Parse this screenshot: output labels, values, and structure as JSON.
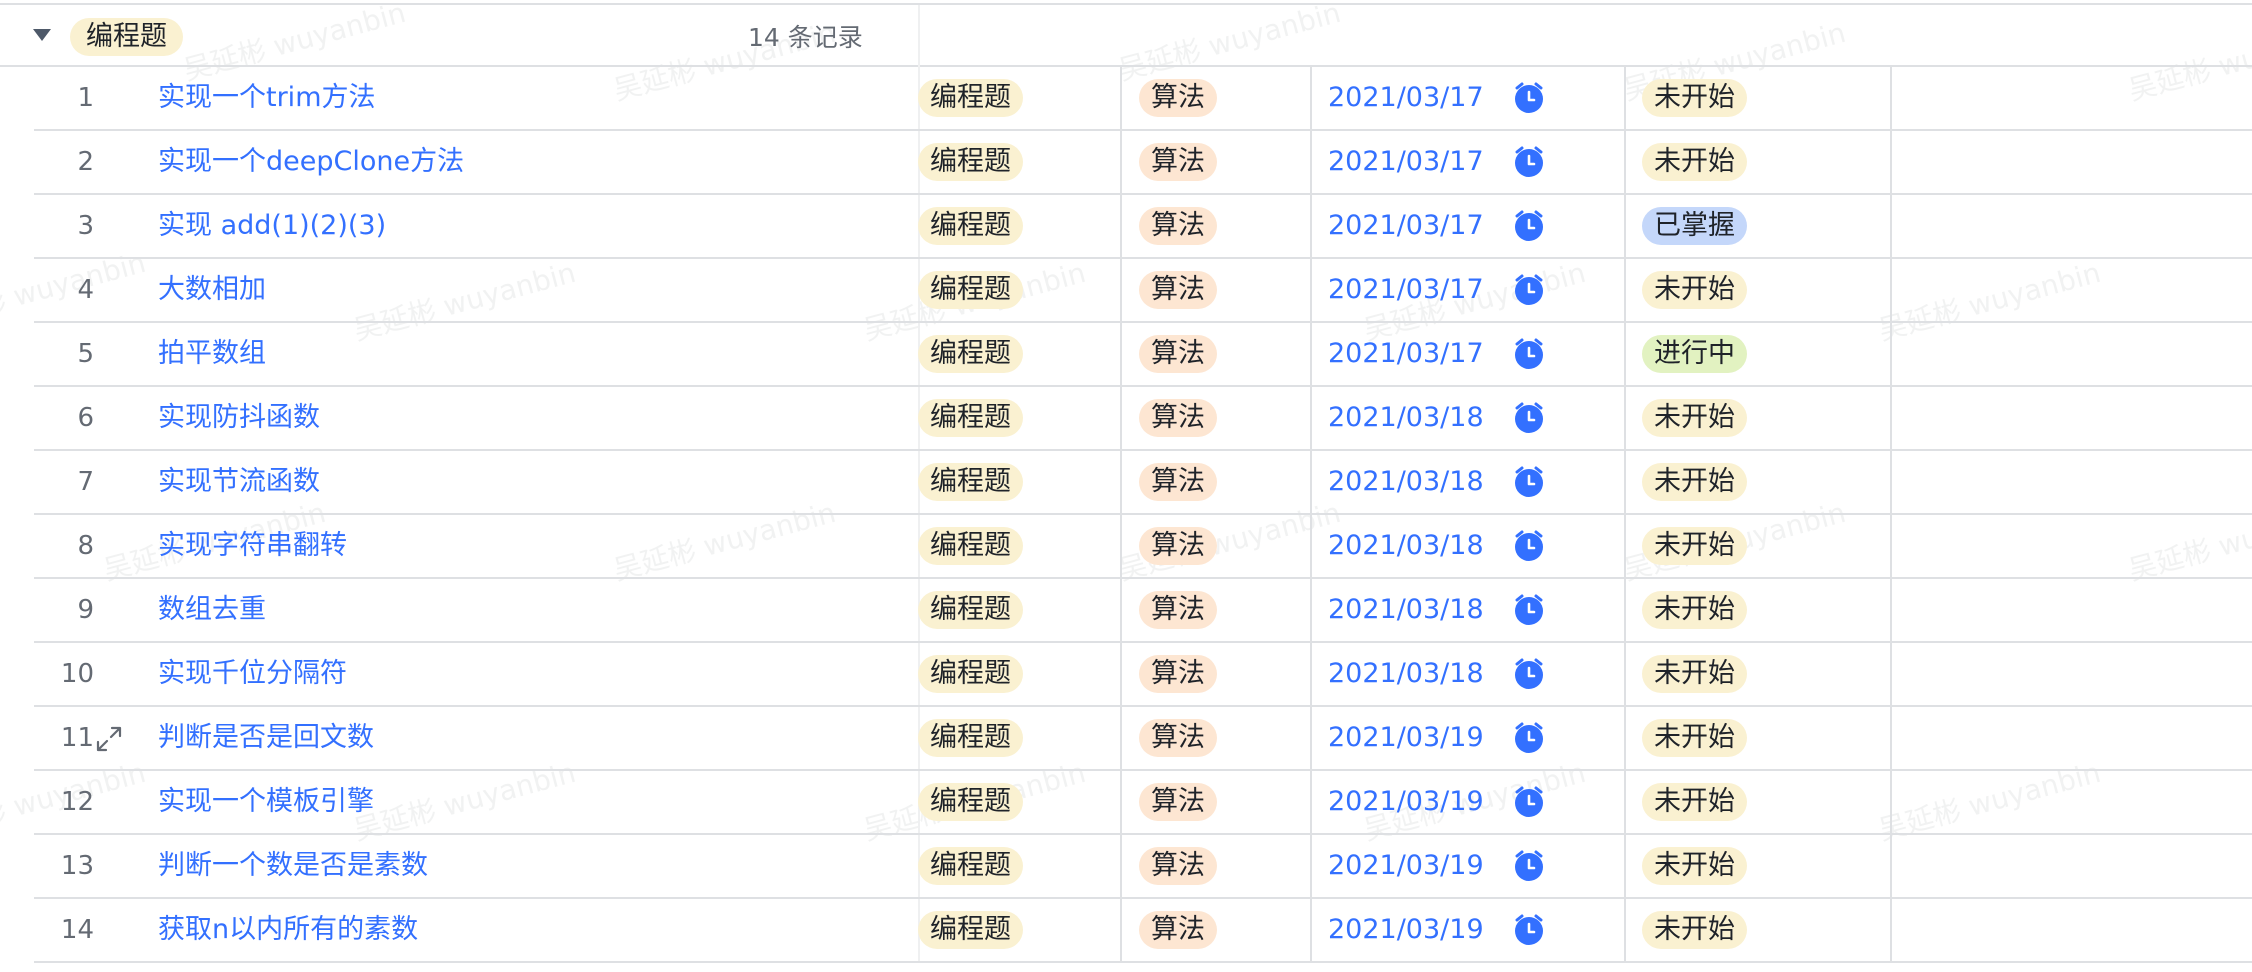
{
  "group": {
    "label": "编程题",
    "count_text": "14 条记录"
  },
  "watermark": "吴延彬 wuyanbin",
  "colors": {
    "link": "#3370ff",
    "tag_yellow": "#faf1d1",
    "tag_orange": "#fde6d2",
    "tag_blue": "#c4d7fa",
    "tag_green": "#e2f2c1",
    "alarm": "#3370ff"
  },
  "icons": {
    "toggle": "caret-down-icon",
    "expand": "expand-icon",
    "alarm": "alarm-clock-icon"
  },
  "rows": [
    {
      "num": "1",
      "title": "实现一个trim方法",
      "type": "编程题",
      "category": "算法",
      "date": "2021/03/17",
      "status": "未开始",
      "status_kind": "notstarted"
    },
    {
      "num": "2",
      "title": "实现一个deepClone方法",
      "type": "编程题",
      "category": "算法",
      "date": "2021/03/17",
      "status": "未开始",
      "status_kind": "notstarted"
    },
    {
      "num": "3",
      "title": "实现 add(1)(2)(3)",
      "type": "编程题",
      "category": "算法",
      "date": "2021/03/17",
      "status": "已掌握",
      "status_kind": "mastered"
    },
    {
      "num": "4",
      "title": "大数相加",
      "type": "编程题",
      "category": "算法",
      "date": "2021/03/17",
      "status": "未开始",
      "status_kind": "notstarted"
    },
    {
      "num": "5",
      "title": "拍平数组",
      "type": "编程题",
      "category": "算法",
      "date": "2021/03/17",
      "status": "进行中",
      "status_kind": "inprogress"
    },
    {
      "num": "6",
      "title": "实现防抖函数",
      "type": "编程题",
      "category": "算法",
      "date": "2021/03/18",
      "status": "未开始",
      "status_kind": "notstarted"
    },
    {
      "num": "7",
      "title": "实现节流函数",
      "type": "编程题",
      "category": "算法",
      "date": "2021/03/18",
      "status": "未开始",
      "status_kind": "notstarted"
    },
    {
      "num": "8",
      "title": "实现字符串翻转",
      "type": "编程题",
      "category": "算法",
      "date": "2021/03/18",
      "status": "未开始",
      "status_kind": "notstarted"
    },
    {
      "num": "9",
      "title": "数组去重",
      "type": "编程题",
      "category": "算法",
      "date": "2021/03/18",
      "status": "未开始",
      "status_kind": "notstarted"
    },
    {
      "num": "10",
      "title": "实现千位分隔符",
      "type": "编程题",
      "category": "算法",
      "date": "2021/03/18",
      "status": "未开始",
      "status_kind": "notstarted"
    },
    {
      "num": "11",
      "title": "判断是否是回文数",
      "type": "编程题",
      "category": "算法",
      "date": "2021/03/19",
      "status": "未开始",
      "status_kind": "notstarted",
      "show_expand": true
    },
    {
      "num": "12",
      "title": "实现一个模板引擎",
      "type": "编程题",
      "category": "算法",
      "date": "2021/03/19",
      "status": "未开始",
      "status_kind": "notstarted"
    },
    {
      "num": "13",
      "title": "判断一个数是否是素数",
      "type": "编程题",
      "category": "算法",
      "date": "2021/03/19",
      "status": "未开始",
      "status_kind": "notstarted"
    },
    {
      "num": "14",
      "title": "获取n以内所有的素数",
      "type": "编程题",
      "category": "算法",
      "date": "2021/03/19",
      "status": "未开始",
      "status_kind": "notstarted"
    }
  ]
}
